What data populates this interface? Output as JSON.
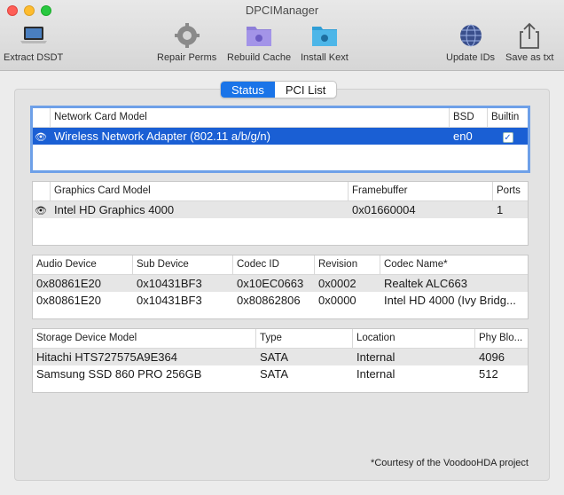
{
  "window": {
    "title": "DPCIManager"
  },
  "toolbar": {
    "extract_dsdt": "Extract DSDT",
    "repair_perms": "Repair Perms",
    "rebuild_cache": "Rebuild Cache",
    "install_kext": "Install Kext",
    "update_ids": "Update IDs",
    "save_as_txt": "Save as txt"
  },
  "tabs": {
    "status": "Status",
    "pci_list": "PCI List",
    "active": "Status"
  },
  "network": {
    "headers": [
      "Network Card Model",
      "BSD",
      "Builtin"
    ],
    "rows": [
      {
        "model": "Wireless Network Adapter (802.11 a/b/g/n)",
        "bsd": "en0",
        "builtin": "true"
      }
    ]
  },
  "graphics": {
    "headers": [
      "Graphics Card Model",
      "Framebuffer",
      "Ports"
    ],
    "rows": [
      {
        "model": "Intel HD Graphics 4000",
        "framebuffer": "0x01660004",
        "ports": "1"
      }
    ]
  },
  "audio": {
    "headers": [
      "Audio Device",
      "Sub Device",
      "Codec ID",
      "Revision",
      "Codec Name*"
    ],
    "rows": [
      {
        "device": "0x80861E20",
        "sub": "0x10431BF3",
        "codec": "0x10EC0663",
        "rev": "0x0002",
        "name": "Realtek ALC663"
      },
      {
        "device": "0x80861E20",
        "sub": "0x10431BF3",
        "codec": "0x80862806",
        "rev": "0x0000",
        "name": "Intel HD 4000 (Ivy Bridg..."
      }
    ]
  },
  "storage": {
    "headers": [
      "Storage Device Model",
      "Type",
      "Location",
      "Phy Blo..."
    ],
    "rows": [
      {
        "model": "Hitachi HTS727575A9E364",
        "type": "SATA",
        "location": "Internal",
        "block": "4096"
      },
      {
        "model": "Samsung SSD 860 PRO 256GB",
        "type": "SATA",
        "location": "Internal",
        "block": "512"
      }
    ]
  },
  "footer": {
    "note": "*Courtesy of the VoodooHDA project"
  },
  "colors": {
    "accent": "#1a74e8",
    "selection": "#1a5fd4"
  }
}
